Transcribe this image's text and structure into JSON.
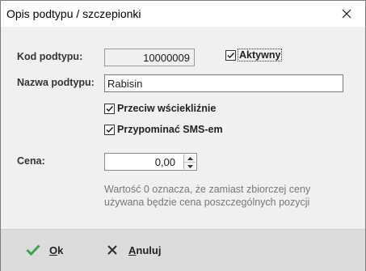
{
  "window": {
    "title": "Opis podtypu / szczepionki"
  },
  "form": {
    "code_label": "Kod podtypu:",
    "code_value": "10000009",
    "active_label": "Aktywny",
    "active_checked": true,
    "name_label": "Nazwa podtypu:",
    "name_value": "Rabisin",
    "rabies_label": "Przeciw wściekliźnie",
    "rabies_checked": true,
    "sms_label": "Przypominać SMS-em",
    "sms_checked": true,
    "price_label": "Cena:",
    "price_value": "0,00",
    "hint": "Wartość 0 oznacza, że zamiast zbiorczej ceny używana będzie cena poszczególnych pozycji"
  },
  "footer": {
    "ok_label_first": "O",
    "ok_label_rest": "k",
    "cancel_label_first": "A",
    "cancel_label_rest": "nuluj"
  },
  "colors": {
    "ok_icon": "#3aa54a",
    "cancel_icon": "#333333",
    "footer_bg": "#dcdcdc"
  },
  "icons": {
    "close": "close-icon",
    "ok": "checkmark-icon",
    "cancel": "x-icon"
  }
}
